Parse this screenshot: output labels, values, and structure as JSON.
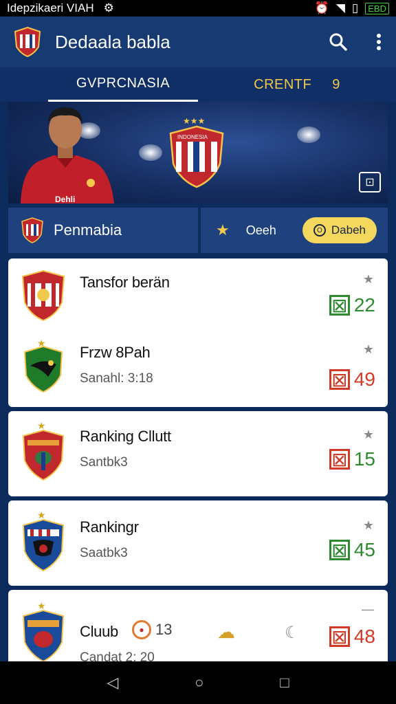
{
  "status_bar": {
    "left_text": "Idepzikaeri VIAH",
    "battery": "EBD"
  },
  "app_bar": {
    "title": "Dedaala babla",
    "search_icon": "search-icon",
    "menu_icon": "more-vert-icon"
  },
  "tabs": [
    {
      "label": "GVPRCNASIA"
    },
    {
      "label": "CRENTF",
      "badge": "9"
    }
  ],
  "hero": {
    "crest_text": "INDONESIA",
    "jersey_text": "Dehli"
  },
  "filter": {
    "team_label": "Penmabia",
    "option_label": "Oeeh",
    "pill_label": "Dabeh",
    "pill_icon": "O"
  },
  "rows": [
    {
      "name": "Tansfor berän",
      "subtitle": "",
      "score": "22",
      "color": "green"
    },
    {
      "name": "Frzw 8Pah",
      "subtitle": "Sanahl: 3:18",
      "score": "49",
      "color": "red"
    },
    {
      "name": "Ranking Cllutt",
      "subtitle": "Santbk3",
      "score": "15",
      "color": "green"
    },
    {
      "name": "Rankingr",
      "subtitle": "Saatbk3",
      "score": "45",
      "color": "green"
    },
    {
      "name": "Cluub",
      "subtitle": "Candat 2: 20",
      "score": "48",
      "color": "red",
      "extra": "13"
    }
  ],
  "colors": {
    "accent": "#f4d85e",
    "green": "#2e8a2e",
    "red": "#d23a26",
    "appbar": "#173a73"
  }
}
